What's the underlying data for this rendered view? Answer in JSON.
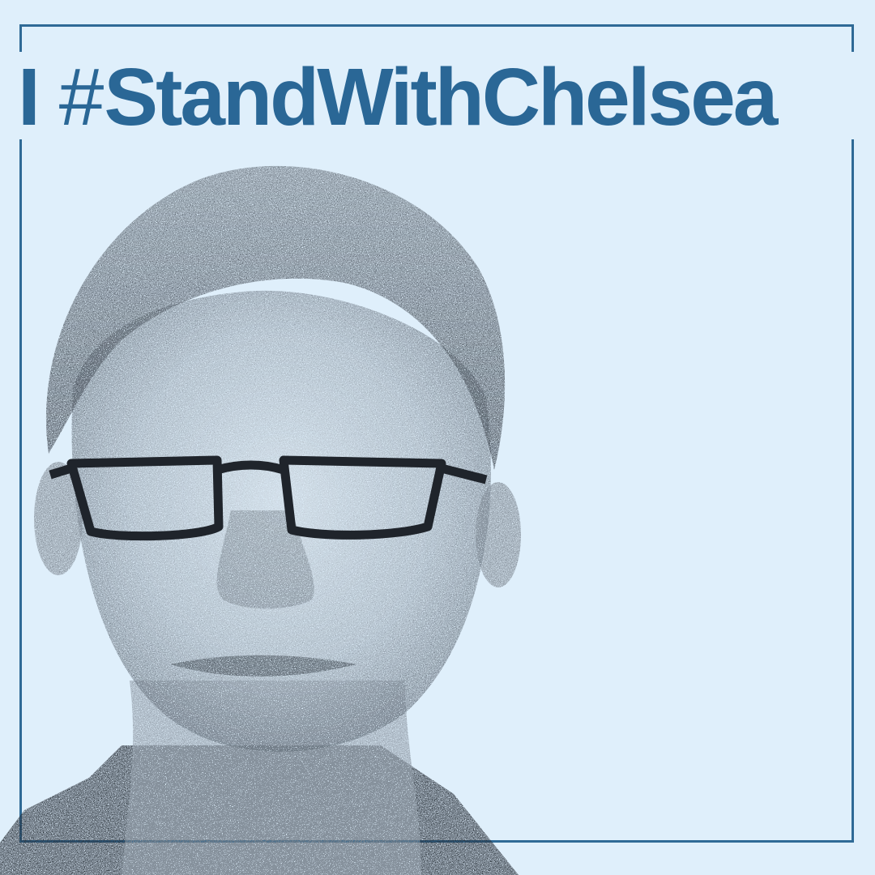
{
  "headline": {
    "prefix": "I",
    "hash": "#",
    "tag": "StandWithChelsea"
  },
  "colors": {
    "background": "#dfeffb",
    "accent": "#2a6796",
    "ink": "#2b3038"
  },
  "portrait": {
    "alt": "halftone portrait"
  }
}
